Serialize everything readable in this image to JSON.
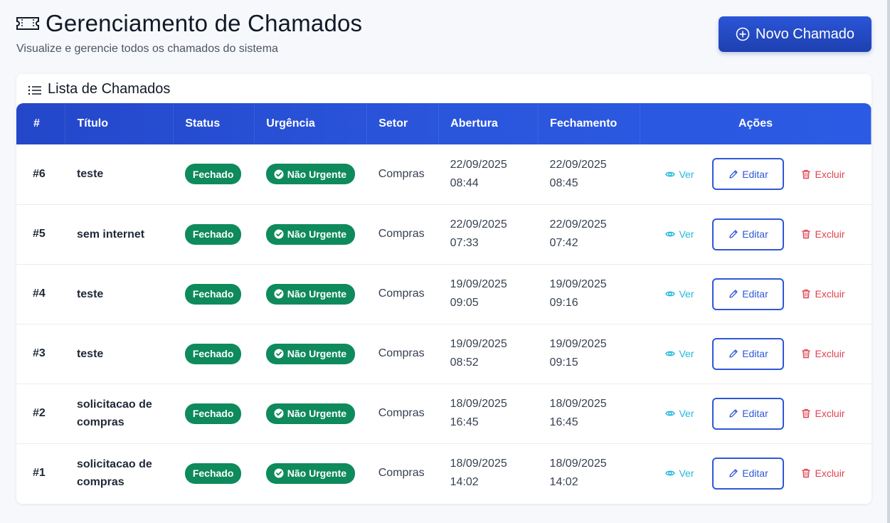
{
  "header": {
    "title": "Gerenciamento de Chamados",
    "subtitle": "Visualize e gerencie todos os chamados do sistema",
    "new_button_label": "Novo Chamado",
    "icon": "ticket-icon"
  },
  "card": {
    "title": "Lista de Chamados",
    "icon": "list-icon"
  },
  "table": {
    "columns": [
      "#",
      "Título",
      "Status",
      "Urgência",
      "Setor",
      "Abertura",
      "Fechamento",
      "Ações"
    ],
    "action_labels": {
      "view": "Ver",
      "edit": "Editar",
      "delete": "Excluir"
    },
    "rows": [
      {
        "id": "#6",
        "title": "teste",
        "status": "Fechado",
        "urgency": "Não Urgente",
        "sector": "Compras",
        "opened_date": "22/09/2025",
        "opened_time": "08:44",
        "closed_date": "22/09/2025",
        "closed_time": "08:45"
      },
      {
        "id": "#5",
        "title": "sem internet",
        "status": "Fechado",
        "urgency": "Não Urgente",
        "sector": "Compras",
        "opened_date": "22/09/2025",
        "opened_time": "07:33",
        "closed_date": "22/09/2025",
        "closed_time": "07:42"
      },
      {
        "id": "#4",
        "title": "teste",
        "status": "Fechado",
        "urgency": "Não Urgente",
        "sector": "Compras",
        "opened_date": "19/09/2025",
        "opened_time": "09:05",
        "closed_date": "19/09/2025",
        "closed_time": "09:16"
      },
      {
        "id": "#3",
        "title": "teste",
        "status": "Fechado",
        "urgency": "Não Urgente",
        "sector": "Compras",
        "opened_date": "19/09/2025",
        "opened_time": "08:52",
        "closed_date": "19/09/2025",
        "closed_time": "09:15"
      },
      {
        "id": "#2",
        "title": "solicitacao de compras",
        "status": "Fechado",
        "urgency": "Não Urgente",
        "sector": "Compras",
        "opened_date": "18/09/2025",
        "opened_time": "16:45",
        "closed_date": "18/09/2025",
        "closed_time": "16:45"
      },
      {
        "id": "#1",
        "title": "solicitacao de compras",
        "status": "Fechado",
        "urgency": "Não Urgente",
        "sector": "Compras",
        "opened_date": "18/09/2025",
        "opened_time": "14:02",
        "closed_date": "18/09/2025",
        "closed_time": "14:02"
      }
    ]
  },
  "colors": {
    "primary": "#2a55d8",
    "status_green": "#0e8a5c",
    "view_cyan": "#22b8e0",
    "delete_red": "#e0424f"
  }
}
